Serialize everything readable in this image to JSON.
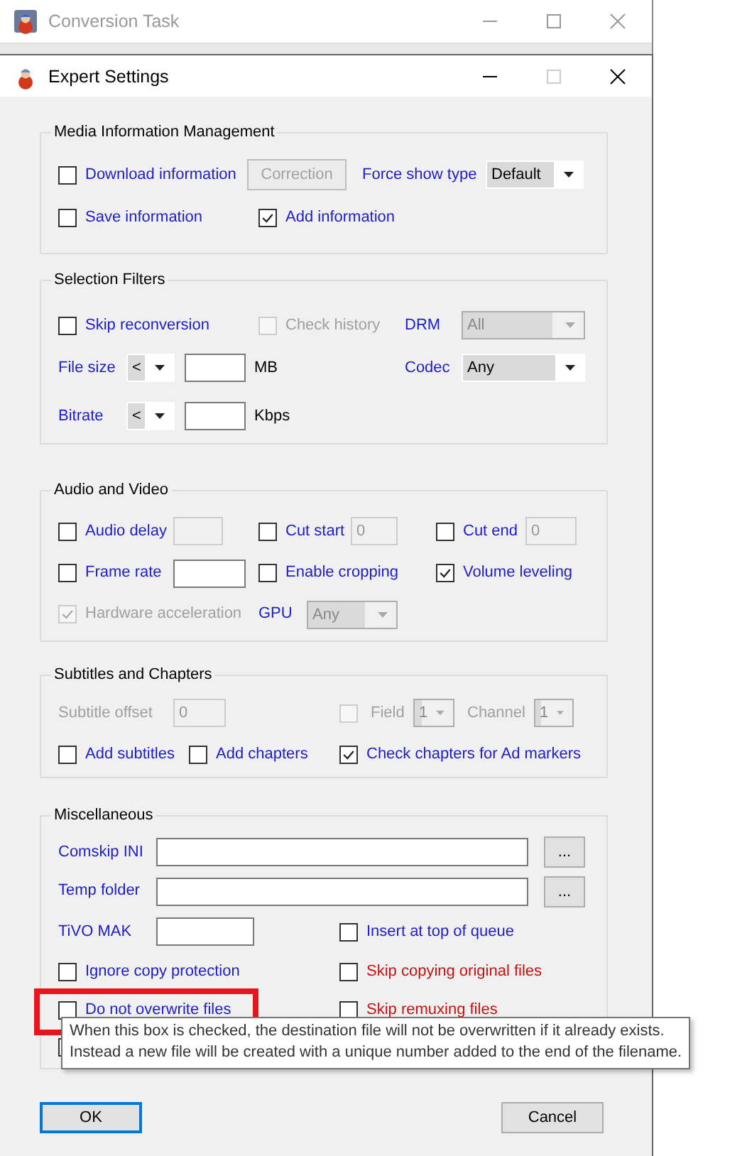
{
  "background_window": {
    "title": "Conversion Task"
  },
  "window": {
    "title": "Expert Settings"
  },
  "sections": [
    {
      "title": "Media Information Management",
      "rows": [
        {
          "controls": [
            {
              "kind": "checkbox",
              "label": "Download information",
              "checked": false,
              "disabled": false
            },
            {
              "kind": "button",
              "label": "Correction",
              "disabled": true
            },
            {
              "kind": "label",
              "label": "Force show type",
              "disabled": false
            },
            {
              "kind": "dropdown",
              "value": "Default",
              "disabled": false
            }
          ]
        },
        {
          "controls": [
            {
              "kind": "checkbox",
              "label": "Save information",
              "checked": false,
              "disabled": false
            },
            {
              "kind": "checkbox",
              "label": "Add information",
              "checked": true,
              "disabled": false
            }
          ]
        }
      ]
    },
    {
      "title": "Selection Filters",
      "rows": [
        {
          "controls": [
            {
              "kind": "checkbox",
              "label": "Skip reconversion",
              "checked": false,
              "disabled": false
            },
            {
              "kind": "checkbox",
              "label": "Check history",
              "checked": false,
              "disabled": true
            },
            {
              "kind": "label",
              "label": "DRM",
              "disabled": false
            },
            {
              "kind": "dropdown",
              "value": "All",
              "disabled": true
            }
          ]
        },
        {
          "controls": [
            {
              "kind": "label",
              "label": "File size",
              "disabled": false
            },
            {
              "kind": "dropdown",
              "value": "<",
              "disabled": false
            },
            {
              "kind": "textbox",
              "disabled": false
            },
            {
              "kind": "unit",
              "label": "MB"
            },
            {
              "kind": "label",
              "label": "Codec",
              "disabled": false
            },
            {
              "kind": "dropdown",
              "value": "Any",
              "disabled": false
            }
          ]
        },
        {
          "controls": [
            {
              "kind": "label",
              "label": "Bitrate",
              "disabled": false
            },
            {
              "kind": "dropdown",
              "value": "<",
              "disabled": false
            },
            {
              "kind": "textbox",
              "disabled": false
            },
            {
              "kind": "unit",
              "label": "Kbps"
            }
          ]
        }
      ]
    },
    {
      "title": "Audio and Video",
      "rows": [
        {
          "controls": [
            {
              "kind": "checkbox",
              "label": "Audio delay",
              "checked": false,
              "disabled": false
            },
            {
              "kind": "textbox",
              "disabled": true
            },
            {
              "kind": "checkbox",
              "label": "Cut start",
              "checked": false,
              "disabled": false
            },
            {
              "kind": "textbox",
              "value": "0",
              "disabled": true
            },
            {
              "kind": "checkbox",
              "label": "Cut end",
              "checked": false,
              "disabled": false
            },
            {
              "kind": "textbox",
              "value": "0",
              "disabled": true
            }
          ]
        },
        {
          "controls": [
            {
              "kind": "checkbox",
              "label": "Frame rate",
              "checked": false,
              "disabled": false
            },
            {
              "kind": "textbox",
              "disabled": false
            },
            {
              "kind": "checkbox",
              "label": "Enable cropping",
              "checked": false,
              "disabled": false
            },
            {
              "kind": "checkbox",
              "label": "Volume leveling",
              "checked": true,
              "disabled": false
            }
          ]
        },
        {
          "controls": [
            {
              "kind": "checkbox",
              "label": "Hardware acceleration",
              "checked": true,
              "disabled": true
            },
            {
              "kind": "label",
              "label": "GPU",
              "disabled": false
            },
            {
              "kind": "dropdown",
              "value": "Any",
              "disabled": true
            }
          ]
        }
      ]
    },
    {
      "title": "Subtitles and Chapters",
      "rows": [
        {
          "controls": [
            {
              "kind": "label",
              "label": "Subtitle offset",
              "disabled": true
            },
            {
              "kind": "textbox",
              "value": "0",
              "disabled": true
            },
            {
              "kind": "checkbox",
              "checked": false,
              "disabled": true
            },
            {
              "kind": "label",
              "label": "Field",
              "disabled": true
            },
            {
              "kind": "dropdown",
              "value": "1",
              "disabled": true
            },
            {
              "kind": "label",
              "label": "Channel",
              "disabled": true
            },
            {
              "kind": "dropdown",
              "value": "1",
              "disabled": true
            }
          ]
        },
        {
          "controls": [
            {
              "kind": "checkbox",
              "label": "Add subtitles",
              "checked": false,
              "disabled": false
            },
            {
              "kind": "checkbox",
              "label": "Add chapters",
              "checked": false,
              "disabled": false
            },
            {
              "kind": "checkbox",
              "label": "Check chapters for Ad markers",
              "checked": true,
              "disabled": false
            }
          ]
        }
      ]
    },
    {
      "title": "Miscellaneous",
      "rows": [
        {
          "controls": [
            {
              "kind": "label",
              "label": "Comskip INI",
              "disabled": false
            },
            {
              "kind": "textbox",
              "disabled": false
            },
            {
              "kind": "button",
              "label": "...",
              "disabled": false
            }
          ]
        },
        {
          "controls": [
            {
              "kind": "label",
              "label": "Temp folder",
              "disabled": false
            },
            {
              "kind": "textbox",
              "disabled": false
            },
            {
              "kind": "button",
              "label": "...",
              "disabled": false
            }
          ]
        },
        {
          "controls": [
            {
              "kind": "label",
              "label": "TiVO MAK",
              "disabled": false
            },
            {
              "kind": "textbox",
              "disabled": false
            },
            {
              "kind": "checkbox",
              "label": "Insert at top of queue",
              "checked": false,
              "disabled": false
            }
          ]
        },
        {
          "controls": [
            {
              "kind": "checkbox",
              "label": "Ignore copy protection",
              "checked": false,
              "disabled": false
            },
            {
              "kind": "checkbox",
              "label": "Skip copying original files",
              "checked": false,
              "disabled": false,
              "color": "#cc1010"
            }
          ]
        },
        {
          "controls": [
            {
              "kind": "checkbox",
              "label": "Do not overwrite files",
              "checked": false,
              "disabled": false,
              "annotated": true
            },
            {
              "kind": "checkbox",
              "label": "Skip remuxing files",
              "checked": false,
              "disabled": false,
              "color": "#cc1010"
            }
          ]
        },
        {
          "controls": [
            {
              "kind": "checkbox",
              "disabled": false
            }
          ]
        }
      ]
    }
  ],
  "tooltip": [
    "When this box is checked, the destination file will not be overwritten if it already exists.",
    "Instead a new file will be created with a unique number added to the end of the filename."
  ],
  "buttons": [
    {
      "label": "OK",
      "default": true
    },
    {
      "label": "Cancel",
      "default": false
    }
  ]
}
